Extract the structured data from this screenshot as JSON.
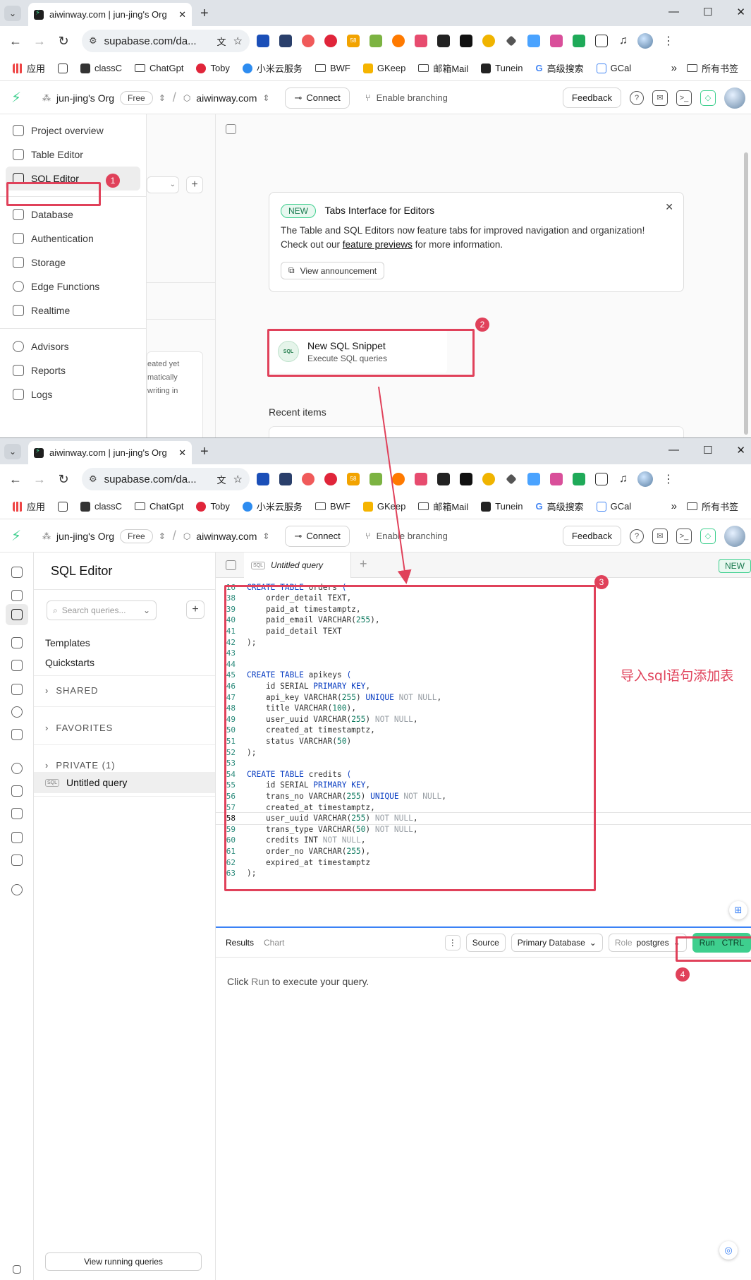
{
  "browser": {
    "tab_title_a": "aiwinway.com | jun-jing's Org",
    "tab_title_b": "aiwinway.com | jun-jing's Org",
    "url": "supabase.com/da...",
    "bookmarks": [
      "应用",
      "classC",
      "ChatGpt",
      "Toby",
      "小米云服务",
      "BWF",
      "GKeep",
      "邮箱Mail",
      "Tunein",
      "高级搜索",
      "GCal"
    ],
    "bookmarks_more": "»",
    "all_bookmarks": "所有书签",
    "ext_badge": "58"
  },
  "header": {
    "org": "jun-jing's Org",
    "plan": "Free",
    "project": "aiwinway.com",
    "connect": "Connect",
    "branching": "Enable branching",
    "feedback": "Feedback"
  },
  "sidebar": {
    "items": [
      "Project overview",
      "Table Editor",
      "SQL Editor",
      "Database",
      "Authentication",
      "Storage",
      "Edge Functions",
      "Realtime",
      "Advisors",
      "Reports",
      "Logs"
    ]
  },
  "ghost_panel": {
    "lines": [
      "eated yet",
      "matically",
      "writing in"
    ]
  },
  "announcement": {
    "badge": "NEW",
    "title": "Tabs Interface for Editors",
    "body_1": "The Table and SQL Editors now feature tabs for improved navigation and organization!",
    "body_2_pre": "Check out our ",
    "body_2_link": "feature previews",
    "body_2_post": " for more information.",
    "button": "View announcement"
  },
  "snippet": {
    "icon_text": "SQL",
    "title": "New SQL Snippet",
    "subtitle": "Execute SQL queries"
  },
  "recent_items": "Recent items",
  "sql_sidebar": {
    "title": "SQL Editor",
    "search_placeholder": "Search queries...",
    "templates": "Templates",
    "quickstarts": "Quickstarts",
    "shared": "SHARED",
    "favorites": "FAVORITES",
    "private": "PRIVATE (1)",
    "query_name": "Untitled query",
    "view_running": "View running queries"
  },
  "editor": {
    "tab_label": "Untitled query",
    "new_badge": "NEW",
    "lines": [
      {
        "n": "16",
        "t": "CREATE TABLE orders ("
      },
      {
        "n": "38",
        "t": "    order_detail TEXT,"
      },
      {
        "n": "39",
        "t": "    paid_at timestamptz,"
      },
      {
        "n": "40",
        "t": "    paid_email VARCHAR(255),"
      },
      {
        "n": "41",
        "t": "    paid_detail TEXT"
      },
      {
        "n": "42",
        "t": ");"
      },
      {
        "n": "43",
        "t": ""
      },
      {
        "n": "44",
        "t": ""
      },
      {
        "n": "45",
        "t": "CREATE TABLE apikeys ("
      },
      {
        "n": "46",
        "t": "    id SERIAL PRIMARY KEY,"
      },
      {
        "n": "47",
        "t": "    api_key VARCHAR(255) UNIQUE NOT NULL,"
      },
      {
        "n": "48",
        "t": "    title VARCHAR(100),"
      },
      {
        "n": "49",
        "t": "    user_uuid VARCHAR(255) NOT NULL,"
      },
      {
        "n": "50",
        "t": "    created_at timestamptz,"
      },
      {
        "n": "51",
        "t": "    status VARCHAR(50)"
      },
      {
        "n": "52",
        "t": ");"
      },
      {
        "n": "53",
        "t": ""
      },
      {
        "n": "54",
        "t": "CREATE TABLE credits ("
      },
      {
        "n": "55",
        "t": "    id SERIAL PRIMARY KEY,"
      },
      {
        "n": "56",
        "t": "    trans_no VARCHAR(255) UNIQUE NOT NULL,"
      },
      {
        "n": "57",
        "t": "    created_at timestamptz,"
      },
      {
        "n": "58",
        "t": "    user_uuid VARCHAR(255) NOT NULL,"
      },
      {
        "n": "59",
        "t": "    trans_type VARCHAR(50) NOT NULL,"
      },
      {
        "n": "60",
        "t": "    credits INT NOT NULL,"
      },
      {
        "n": "61",
        "t": "    order_no VARCHAR(255),"
      },
      {
        "n": "62",
        "t": "    expired_at timestamptz"
      },
      {
        "n": "63",
        "t": ");"
      }
    ],
    "current_line": "58"
  },
  "results": {
    "tab_results": "Results",
    "tab_chart": "Chart",
    "source": "Source",
    "database": "Primary Database",
    "role_label": "Role",
    "role_value": "postgres",
    "run": "Run",
    "run_shortcut": "CTRL",
    "hint_pre": "Click ",
    "hint_run": "Run",
    "hint_post": " to execute your query."
  },
  "annotations": {
    "step1": "1",
    "step2": "2",
    "step3": "3",
    "step4": "4",
    "note": "导入sql语句添加表",
    "color": "#e0415a"
  },
  "colors": {
    "brand": "#3ecf8e",
    "accent_blue": "#3b82f6",
    "keyword": "#0a3ec2"
  }
}
